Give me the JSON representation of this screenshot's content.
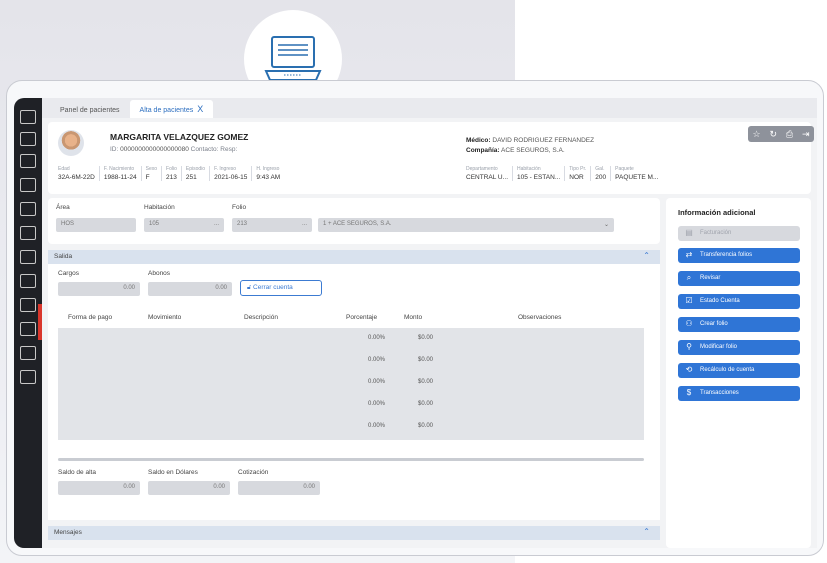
{
  "tabs": [
    {
      "label": "Panel de pacientes"
    },
    {
      "label": "Alta de pacientes",
      "close": "X"
    }
  ],
  "patient": {
    "name": "MARGARITA VELAZQUEZ GOMEZ",
    "id_label": "ID:",
    "id_value": "0000000000000000080",
    "contact_label": "Contacto:",
    "contact_value": "Resp:",
    "fields": [
      {
        "label": "Edad",
        "value": "32A-6M-22D"
      },
      {
        "label": "F. Nacimiento",
        "value": "1988-11-24"
      },
      {
        "label": "Sexo",
        "value": "F"
      },
      {
        "label": "Folio",
        "value": "213"
      },
      {
        "label": "Episodio",
        "value": "251"
      },
      {
        "label": "F. Ingreso",
        "value": "2021-06-15"
      },
      {
        "label": "H. Ingreso",
        "value": "9:43 AM"
      }
    ],
    "doctor_label": "Médico:",
    "doctor_value": "DAVID RODRIGUEZ FERNANDEZ",
    "company_label": "Compañía:",
    "company_value": "ACE SEGUROS, S.A.",
    "right_fields": [
      {
        "label": "Departamento",
        "value": "CENTRAL U..."
      },
      {
        "label": "Habitación",
        "value": "105 - ESTAN..."
      },
      {
        "label": "Tipo Pr.",
        "value": "NOR"
      },
      {
        "label": "Gal.",
        "value": "200"
      },
      {
        "label": "Paquete",
        "value": "PAQUETE M..."
      }
    ]
  },
  "area_row": {
    "area_label": "Área",
    "area_value": "HOS",
    "hab_label": "Habitación",
    "hab_value": "105",
    "folio_label": "Folio",
    "folio_value": "213",
    "company_value": "1 + ACE SEGUROS, S.A.",
    "dots": "..."
  },
  "salida": {
    "title": "Salida",
    "cargos_label": "Cargos",
    "cargos_value": "0.00",
    "abonos_label": "Abonos",
    "abonos_value": "0.00",
    "close_button": "Cerrar cuenta",
    "columns": [
      "Forma de pago",
      "Movimiento",
      "Descripción",
      "Porcentaje",
      "Monto",
      "Observaciones"
    ],
    "rows": [
      {
        "porcentaje": "0.00%",
        "monto": "$0.00"
      },
      {
        "porcentaje": "0.00%",
        "monto": "$0.00"
      },
      {
        "porcentaje": "0.00%",
        "monto": "$0.00"
      },
      {
        "porcentaje": "0.00%",
        "monto": "$0.00"
      },
      {
        "porcentaje": "0.00%",
        "monto": "$0.00"
      }
    ],
    "saldo_alta_label": "Saldo de alta",
    "saldo_alta_value": "0.00",
    "saldo_dolares_label": "Saldo en Dólares",
    "saldo_dolares_value": "0.00",
    "cotizacion_label": "Cotización",
    "cotizacion_value": "0.00"
  },
  "mensajes": {
    "title": "Mensajes"
  },
  "info": {
    "title": "Información adicional",
    "buttons": [
      {
        "label": "Facturación",
        "icon": "invoice-icon",
        "disabled": true
      },
      {
        "label": "Transferencia folios",
        "icon": "transfer-icon"
      },
      {
        "label": "Revisar",
        "icon": "search-icon"
      },
      {
        "label": "Estado Cuenta",
        "icon": "checklist-icon"
      },
      {
        "label": "Crear folio",
        "icon": "user-add-icon"
      },
      {
        "label": "Modificar folio",
        "icon": "user-icon"
      },
      {
        "label": "Recálculo de cuenta",
        "icon": "refresh-icon"
      },
      {
        "label": "Transacciones",
        "icon": "dollar-icon"
      }
    ]
  },
  "colors": {
    "accent": "#2f75d6",
    "sidebar": "#1f2126",
    "toggle": "#d9362c"
  }
}
